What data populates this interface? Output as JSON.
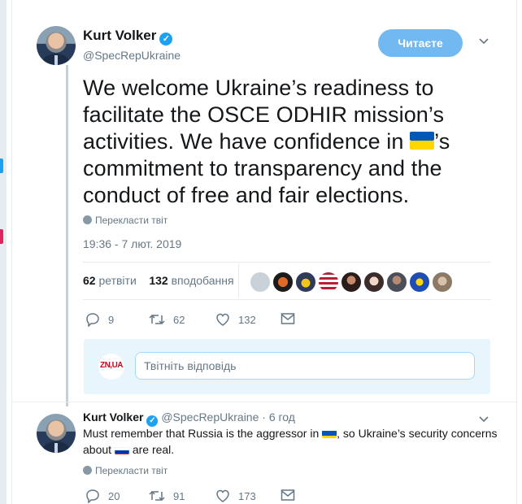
{
  "tweet": {
    "author_name": "Kurt Volker",
    "author_handle": "@SpecRepUkraine",
    "follow_label": "Читаєте",
    "text_part1": "We welcome Ukraine’s readiness to facilitate the OSCE ODHIR mission’s activities. We have confidence in",
    "text_part2": "’s commitment to transparency and the conduct of free and fair elections.",
    "translate_label": "Перекласти твіт",
    "timestamp": "19:36 - 7 лют. 2019",
    "retweets_count": "62",
    "retweets_label": "ретвіти",
    "likes_count": "132",
    "likes_label": "вподобання",
    "actions": {
      "reply": "9",
      "retweet": "62",
      "like": "132"
    }
  },
  "reply_box": {
    "logo_text": "ZN,UA",
    "placeholder": "Твітніть відповідь"
  },
  "reply": {
    "author_name": "Kurt Volker",
    "author_handle": "@SpecRepUkraine",
    "time_sep": "·",
    "time": "6 год",
    "text_part1": "Must remember that Russia is the aggressor in",
    "text_part2": ", so Ukraine’s security concerns about",
    "text_part3": "are real.",
    "translate_label": "Перекласти твіт",
    "actions": {
      "reply": "20",
      "retweet": "91",
      "like": "173"
    }
  },
  "colors": {
    "accent": "#1da1f2",
    "button": "#73b9f1",
    "muted": "#657786",
    "ua_blue": "#0057b7",
    "ua_yellow": "#ffd700"
  }
}
